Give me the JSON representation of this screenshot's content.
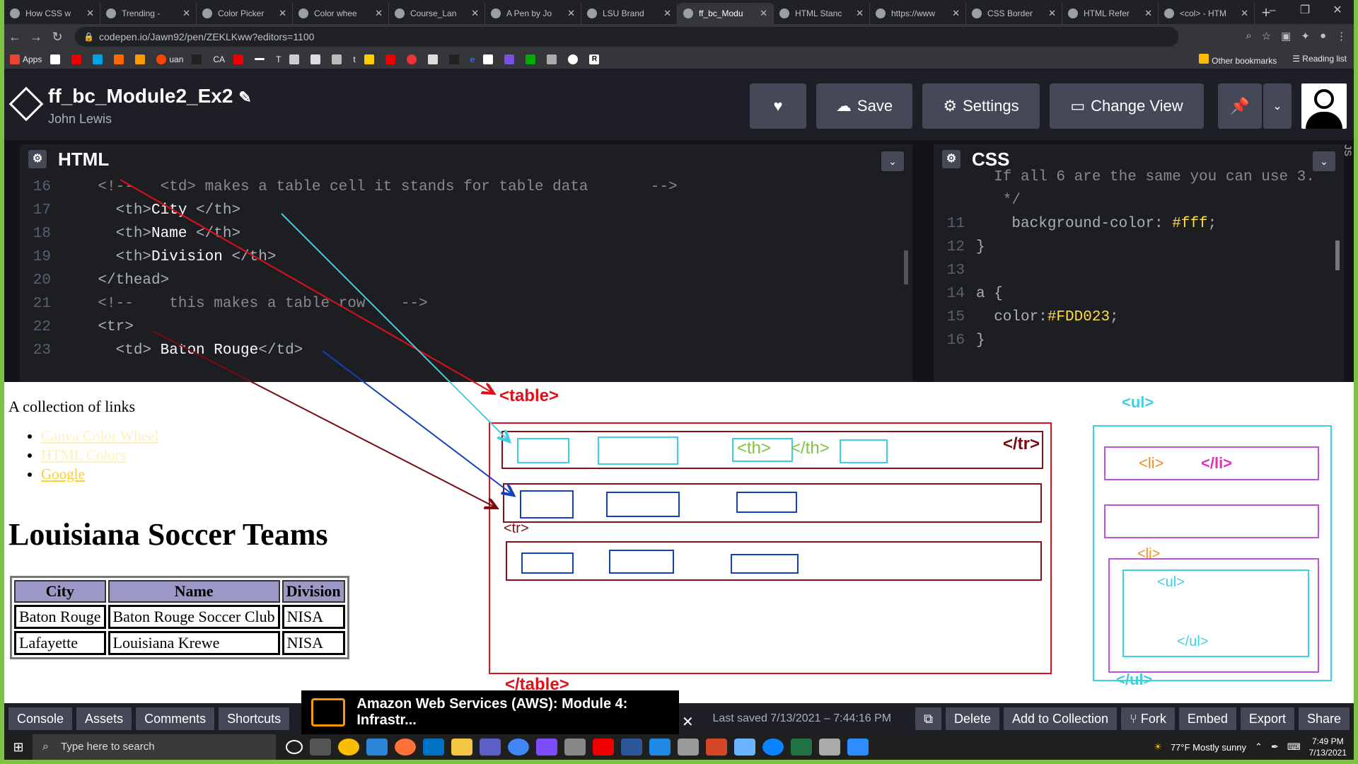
{
  "browser": {
    "tabs": [
      {
        "label": "How CSS w",
        "active": false
      },
      {
        "label": "Trending -",
        "active": false
      },
      {
        "label": "Color Picker",
        "active": false
      },
      {
        "label": "Color whee",
        "active": false
      },
      {
        "label": "Course_Lan",
        "active": false
      },
      {
        "label": "A Pen by Jo",
        "active": false
      },
      {
        "label": "LSU Brand",
        "active": false
      },
      {
        "label": "ff_bc_Modu",
        "active": true
      },
      {
        "label": "HTML Stanc",
        "active": false
      },
      {
        "label": "https://www",
        "active": false
      },
      {
        "label": "CSS Border",
        "active": false
      },
      {
        "label": "HTML Refer",
        "active": false
      },
      {
        "label": "<col> - HTM",
        "active": false
      }
    ],
    "url": "codepen.io/Jawn92/pen/ZEKLKww?editors=1100",
    "bookmarks": [
      "Apps",
      "uan",
      "CA",
      "T",
      "t",
      "e",
      "R"
    ],
    "other_bookmarks": "Other bookmarks",
    "reading_list": "Reading list"
  },
  "codepen": {
    "title": "ff_bc_Module2_Ex2",
    "author": "John Lewis",
    "buttons": {
      "save": "Save",
      "settings": "Settings",
      "change_view": "Change View"
    }
  },
  "html_pane": {
    "title": "HTML",
    "lines": [
      {
        "n": "16",
        "t": "    <!--   <td> makes a table cell it stands for table data       -->"
      },
      {
        "n": "17",
        "t": "      <th>City </th>"
      },
      {
        "n": "18",
        "t": "      <th>Name </th>"
      },
      {
        "n": "19",
        "t": "      <th>Division </th>"
      },
      {
        "n": "20",
        "t": "    </thead>"
      },
      {
        "n": "21",
        "t": "    <!--    this makes a table row    -->"
      },
      {
        "n": "22",
        "t": "    <tr>"
      },
      {
        "n": "23",
        "t": "      <td> Baton Rouge</td>"
      }
    ]
  },
  "css_pane": {
    "title": "CSS",
    "lines": [
      {
        "n": "",
        "t": "  If all 6 are the same you can use 3."
      },
      {
        "n": "",
        "t": "   */"
      },
      {
        "n": "11",
        "t": "    background-color: #fff;"
      },
      {
        "n": "12",
        "t": "}"
      },
      {
        "n": "13",
        "t": ""
      },
      {
        "n": "14",
        "t": "a {"
      },
      {
        "n": "15",
        "t": "  color:#FDD023;"
      },
      {
        "n": "16",
        "t": "}"
      }
    ]
  },
  "preview": {
    "intro": "A collection of links",
    "links": [
      "Canva Color Wheel",
      "HTML Colors",
      "Google"
    ],
    "heading": "Louisiana Soccer Teams",
    "table": {
      "headers": [
        "City",
        "Name",
        "Division"
      ],
      "rows": [
        [
          "Baton Rouge",
          "Baton Rouge Soccer Club",
          "NISA"
        ],
        [
          "Lafayette",
          "Louisiana Krewe",
          "NISA"
        ]
      ]
    },
    "annotations": {
      "table_open": "<table>",
      "table_close": "</table>",
      "th_open": "<th>",
      "th_close": "</th>",
      "tr_close": "</tr>",
      "tr_open": "<tr>",
      "ul_open": "<ul>",
      "ul_close": "</ul>",
      "li_open": "<li>",
      "li_close": "</li>",
      "li_open_2": "<li>",
      "ul_inner_open": "<ul>",
      "ul_inner_close": "</ul>"
    }
  },
  "bottom": {
    "buttons": [
      "Console",
      "Assets",
      "Comments",
      "Shortcuts"
    ],
    "right_buttons": [
      "Delete",
      "Add to Collection",
      "Fork",
      "Embed",
      "Export",
      "Share"
    ],
    "saved": "Last saved 7/13/2021 – 7:44:16 PM",
    "toast": "Amazon Web Services (AWS): Module 4: Infrastr..."
  },
  "taskbar": {
    "search_placeholder": "Type here to search",
    "weather": "77°F  Mostly sunny",
    "time": "7:49 PM",
    "date": "7/13/2021"
  },
  "colors": {
    "link": "#FDD023",
    "accent_red": "#e0101a",
    "accent_cyan": "#3cd0e0",
    "accent_blue": "#1140c0"
  }
}
